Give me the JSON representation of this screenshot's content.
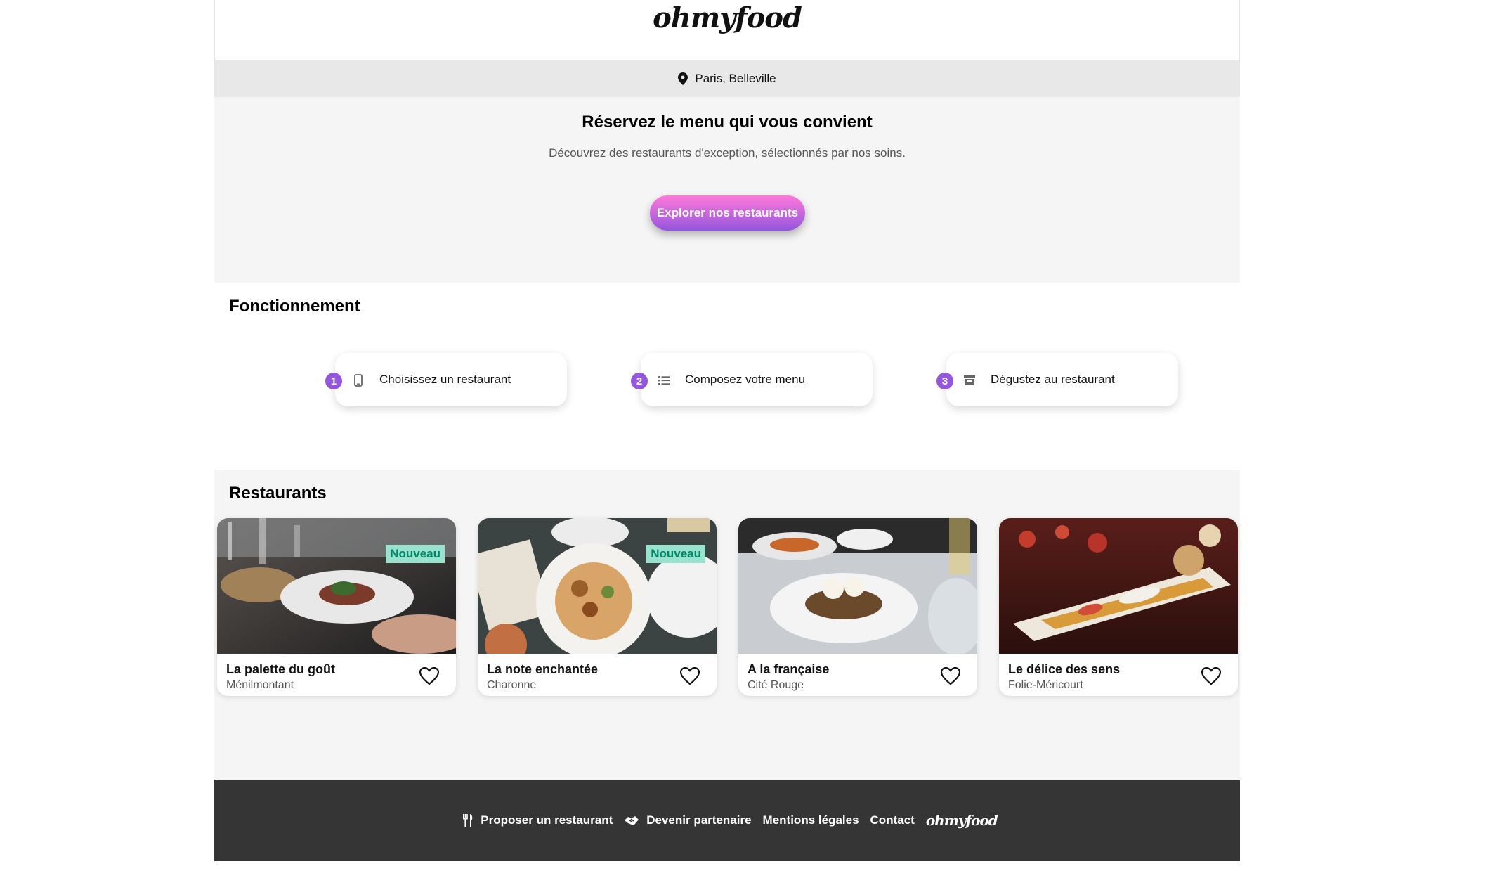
{
  "header": {
    "logo": "ohmyfood"
  },
  "location": {
    "text": "Paris, Belleville",
    "icon": "map-pin-icon"
  },
  "hero": {
    "title": "Réservez le menu qui vous convient",
    "subtitle": "Découvrez des restaurants d'exception, sélectionnés par nos soins.",
    "cta_label": "Explorer nos restaurants"
  },
  "howto": {
    "title": "Fonctionnement",
    "steps": [
      {
        "num": "1",
        "label": "Choisissez un restaurant",
        "icon": "mobile-phone-icon"
      },
      {
        "num": "2",
        "label": "Composez votre menu",
        "icon": "list-icon"
      },
      {
        "num": "3",
        "label": "Dégustez au restaurant",
        "icon": "store-icon"
      }
    ]
  },
  "restaurants": {
    "title": "Restaurants",
    "items": [
      {
        "name": "La palette du goût",
        "area": "Ménilmontant",
        "badge": "Nouveau"
      },
      {
        "name": "La note enchantée",
        "area": "Charonne",
        "badge": "Nouveau"
      },
      {
        "name": "A la française",
        "area": "Cité Rouge",
        "badge": ""
      },
      {
        "name": "Le délice des sens",
        "area": "Folie-Méricourt",
        "badge": ""
      }
    ]
  },
  "footer": {
    "links": [
      {
        "label": "Proposer un restaurant",
        "icon": "utensils-icon"
      },
      {
        "label": "Devenir partenaire",
        "icon": "handshake-icon"
      },
      {
        "label": "Mentions légales"
      },
      {
        "label": "Contact"
      }
    ],
    "logo": "ohmyfood"
  },
  "colors": {
    "accent_start": "#ff79da",
    "accent_end": "#9356dc",
    "badge_bg": "#99e2d0",
    "badge_text": "#008766",
    "footer_bg": "#353535"
  }
}
